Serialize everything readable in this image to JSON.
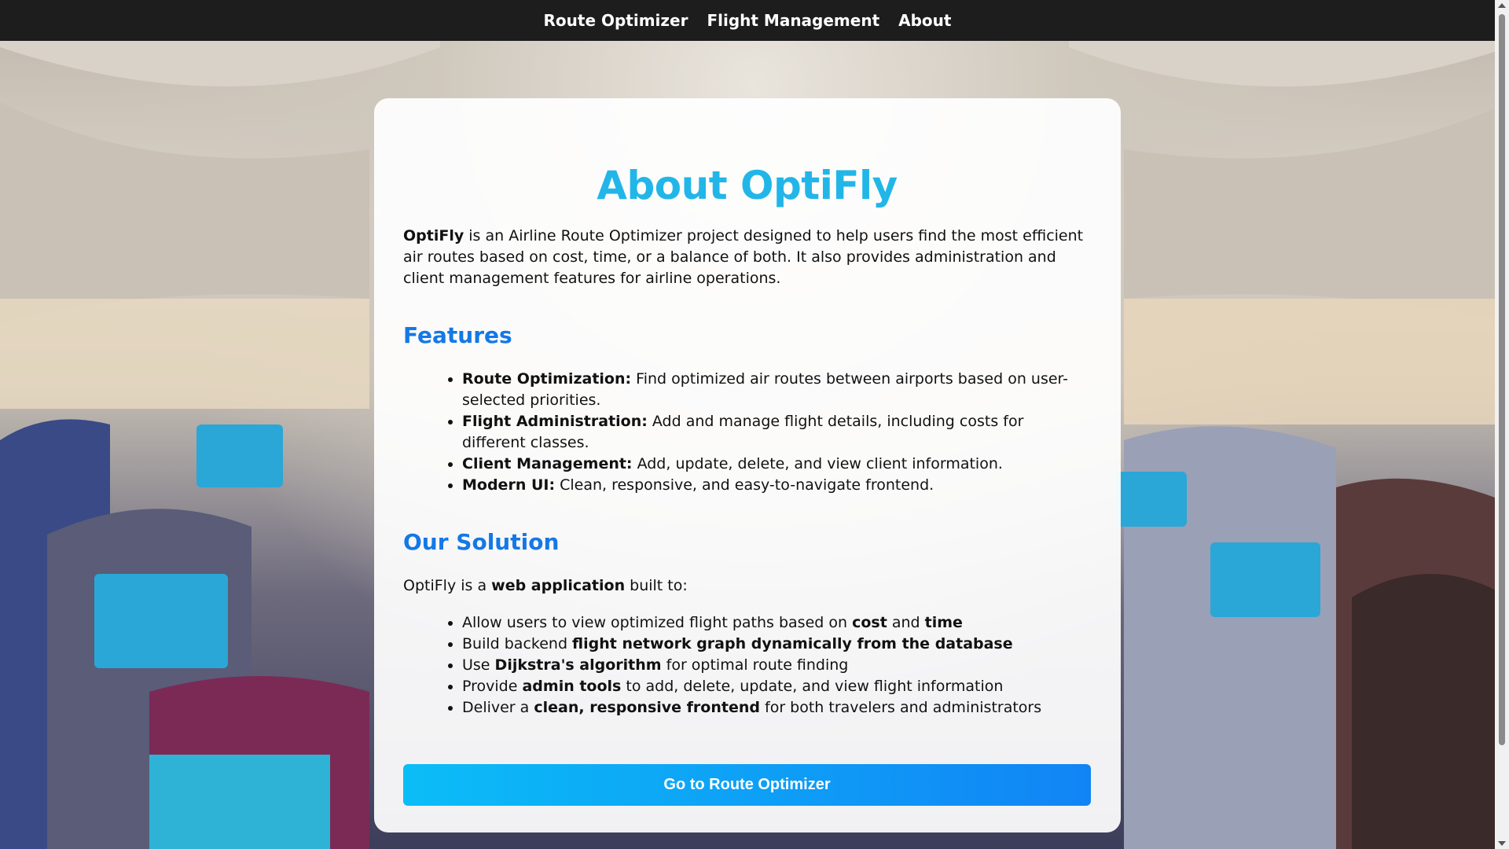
{
  "nav": {
    "items": [
      "Route Optimizer",
      "Flight Management",
      "About"
    ]
  },
  "about": {
    "title": "About OptiFly",
    "intro_brand": "OptiFly",
    "intro_text": " is an Airline Route Optimizer project designed to help users find the most efficient air routes based on cost, time, or a balance of both. It also provides administration and client management features for airline operations."
  },
  "features": {
    "heading": "Features",
    "items": [
      {
        "label": "Route Optimization:",
        "text": " Find optimized air routes between airports based on user-selected priorities."
      },
      {
        "label": "Flight Administration:",
        "text": " Add and manage flight details, including costs for different classes."
      },
      {
        "label": "Client Management:",
        "text": " Add, update, delete, and view client information."
      },
      {
        "label": "Modern UI:",
        "text": " Clean, responsive, and easy-to-navigate frontend."
      }
    ]
  },
  "solution": {
    "heading": "Our Solution",
    "intro_pre": "OptiFly is a ",
    "intro_bold": "web application",
    "intro_post": " built to:",
    "items": [
      {
        "parts": [
          "Allow users to view optimized flight paths based on ",
          "cost",
          " and ",
          "time",
          ""
        ]
      },
      {
        "parts": [
          "Build backend ",
          "flight network graph dynamically from the database",
          "",
          "",
          ""
        ]
      },
      {
        "parts": [
          "Use ",
          "Dijkstra's algorithm",
          " for optimal route finding",
          "",
          ""
        ]
      },
      {
        "parts": [
          "Provide ",
          "admin tools",
          " to add, delete, update, and view flight information",
          "",
          ""
        ]
      },
      {
        "parts": [
          "Deliver a ",
          "clean, responsive frontend",
          " for both travelers and administrators",
          "",
          ""
        ]
      }
    ]
  },
  "cta": {
    "label": "Go to Route Optimizer"
  },
  "colors": {
    "navbar": "#1d1d1d",
    "title": "#22b6e8",
    "heading": "#1478e6",
    "button_start": "#0bbdf7",
    "button_end": "#1184f5"
  }
}
